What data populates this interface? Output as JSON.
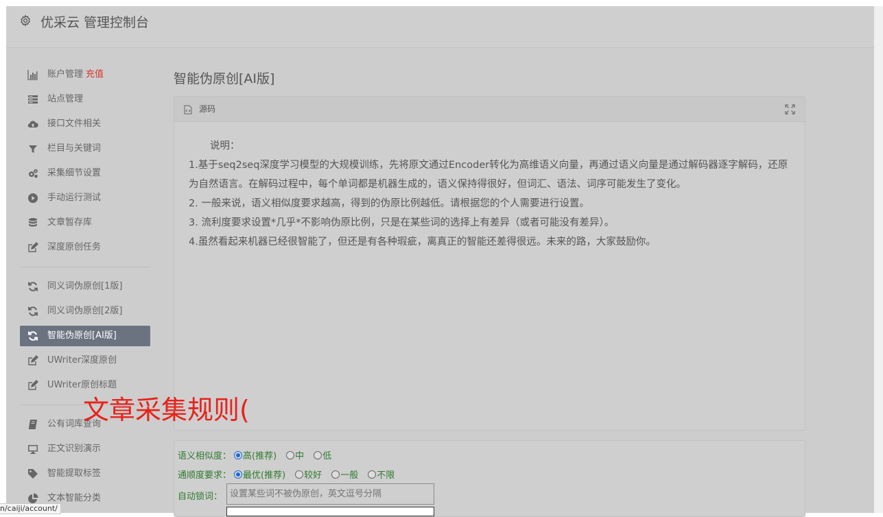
{
  "header": {
    "title": "优采云 管理控制台",
    "icon": "gear-icon"
  },
  "sidebar": {
    "group1": [
      {
        "label": "账户管理",
        "extra": "充值",
        "icon": "bar-chart-icon"
      },
      {
        "label": "站点管理",
        "icon": "server-icon"
      },
      {
        "label": "接口文件相关",
        "icon": "cloud-upload-icon"
      },
      {
        "label": "栏目与关键词",
        "icon": "filter-icon"
      },
      {
        "label": "采集细节设置",
        "icon": "gears-icon"
      },
      {
        "label": "手动运行测试",
        "icon": "play-circle-icon"
      },
      {
        "label": "文章暂存库",
        "icon": "database-icon"
      },
      {
        "label": "深度原创任务",
        "icon": "edit-icon"
      }
    ],
    "group2": [
      {
        "label": "同义词伪原创[1版]",
        "icon": "refresh-icon"
      },
      {
        "label": "同义词伪原创[2版]",
        "icon": "refresh-icon"
      },
      {
        "label": "智能伪原创[AI版]",
        "icon": "refresh-icon",
        "active": true
      },
      {
        "label": "UWriter深度原创",
        "icon": "edit-icon"
      },
      {
        "label": "UWriter原创标题",
        "icon": "edit-icon"
      }
    ],
    "group3": [
      {
        "label": "公有词库查询",
        "icon": "book-icon"
      },
      {
        "label": "正文识别演示",
        "icon": "monitor-icon"
      },
      {
        "label": "智能提取标签",
        "icon": "tag-icon"
      },
      {
        "label": "文本智能分类",
        "icon": "pie-chart-icon"
      }
    ]
  },
  "main": {
    "title": "智能伪原创[AI版]",
    "panel": {
      "label": "源码",
      "description": [
        "说明：",
        "1.基于seq2seq深度学习模型的大规模训练，先将原文通过Encoder转化为高维语义向量，再通过语义向量是通过解码器逐字解码，还原为自然语言。在解码过程中，每个单词都是机器生成的，语义保持得很好，但词汇、语法、词序可能发生了变化。",
        "2. 一般来说，语义相似度要求越高，得到的伪原比例越低。请根据您的个人需要进行设置。",
        "3. 流利度要求设置*几乎*不影响伪原比例，只是在某些词的选择上有差异（或者可能没有差异）。",
        "4.虽然看起来机器已经很智能了，但还是有各种瑕疵，离真正的智能还差得很远。未来的路，大家鼓励你。"
      ]
    },
    "options": {
      "similarity": {
        "label": "语义相似度：",
        "choices": [
          "高(推荐)",
          "中",
          "低"
        ],
        "selected": 0
      },
      "fluency": {
        "label": "通顺度要求：",
        "choices": [
          "最优(推荐)",
          "较好",
          "一般",
          "不限"
        ],
        "selected": 0
      },
      "lock": {
        "label": "自动锁词：",
        "placeholder": "设置某些词不被伪原创，英文逗号分隔"
      }
    }
  },
  "overlay": {
    "text": "文章采集规则("
  },
  "status": {
    "url": "n/caiji/account/"
  }
}
